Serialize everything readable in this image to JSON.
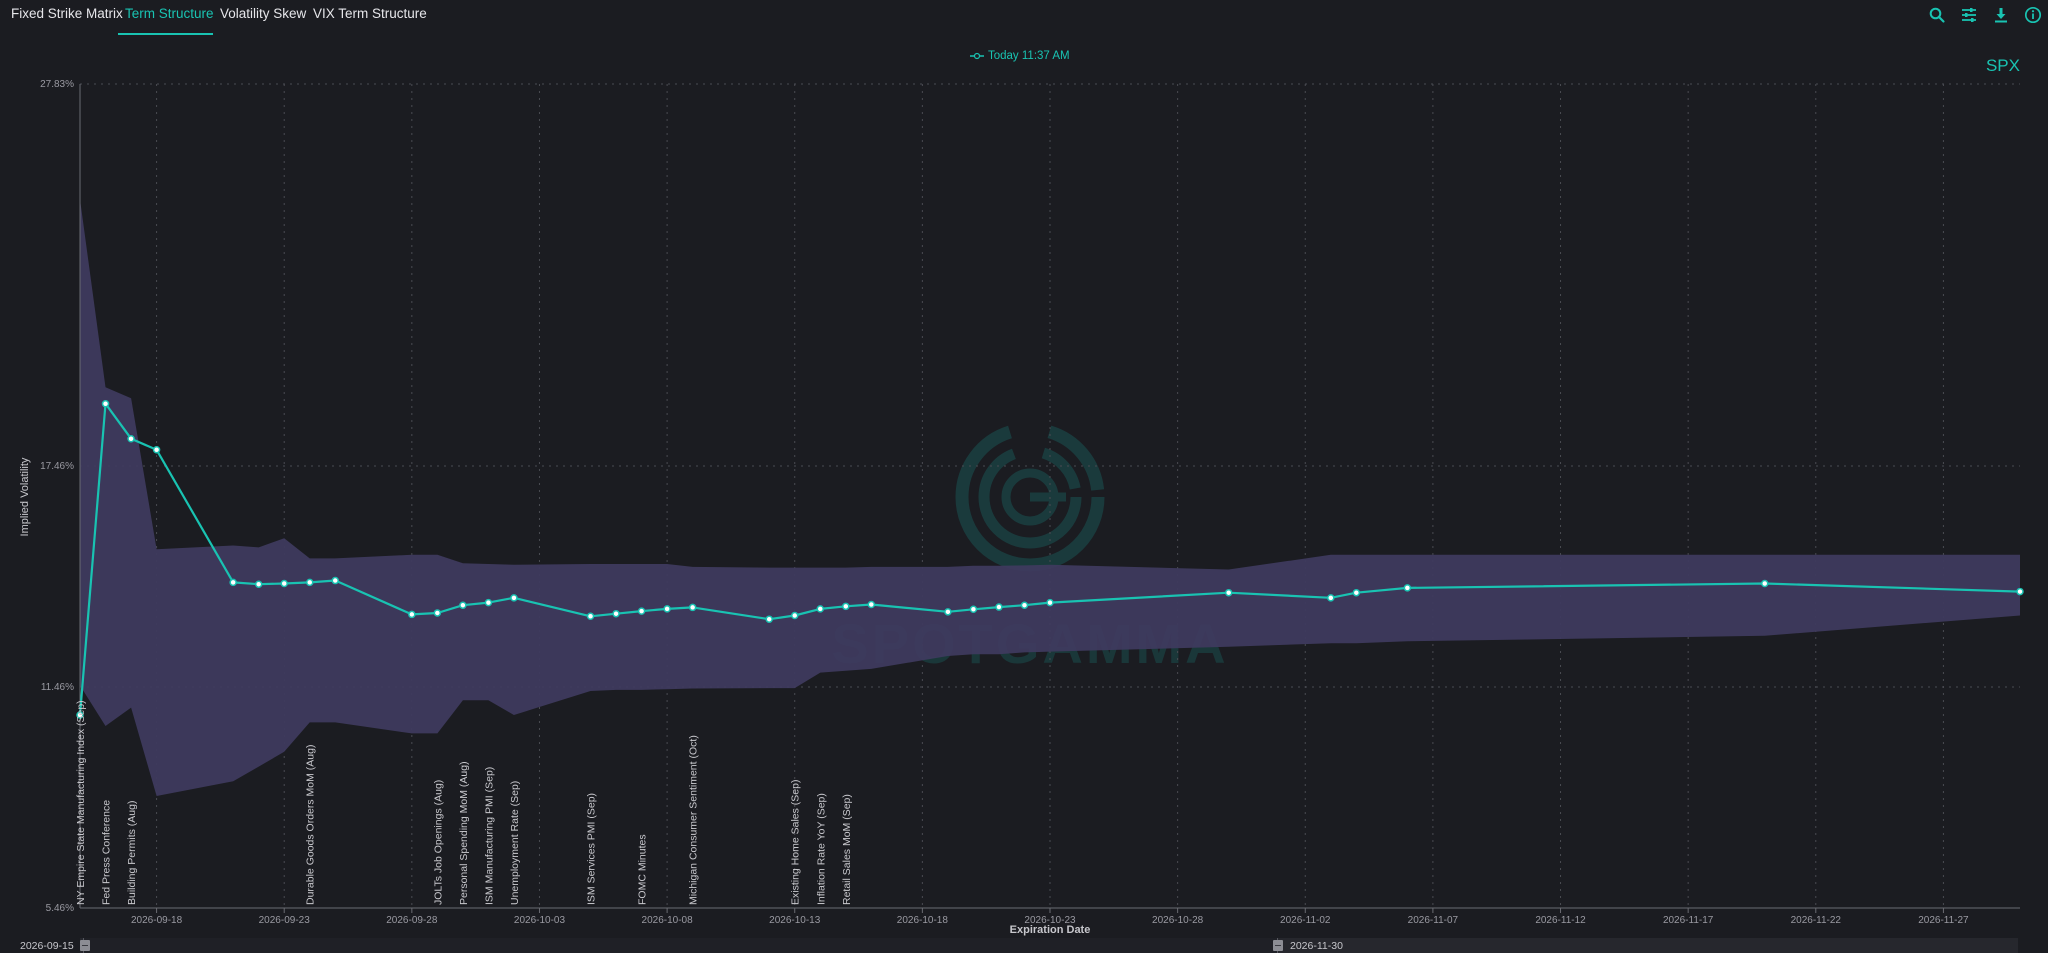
{
  "tabs": [
    {
      "label": "Fixed Strike Matrix",
      "active": false
    },
    {
      "label": "Term Structure",
      "active": true
    },
    {
      "label": "Volatility Skew",
      "active": false
    },
    {
      "label": "VIX Term Structure",
      "active": false
    }
  ],
  "toolbar": {
    "icons": [
      "search-icon",
      "sliders-icon",
      "download-icon",
      "info-icon"
    ]
  },
  "symbol": "SPX",
  "watermark": "SPOTGAMMA",
  "colors": {
    "accent": "#19c3b2",
    "band": "#3e3a5e",
    "background": "#1b1c21"
  },
  "navigator": {
    "start_label": "2026-09-15",
    "end_label": "2026-11-30"
  },
  "chart_data": {
    "type": "line",
    "title": "",
    "xlabel": "Expiration Date",
    "ylabel": "Implied Volatility",
    "x_type": "date",
    "xlim": [
      "2026-09-15",
      "2026-11-30"
    ],
    "ylim": [
      5.46,
      27.83
    ],
    "y_ticks": [
      "27.83%",
      "17.46%",
      "11.46%",
      "5.46%"
    ],
    "y_tick_values": [
      27.83,
      17.46,
      11.46,
      5.46
    ],
    "x_ticks": [
      "2026-09-18",
      "2026-09-23",
      "2026-09-28",
      "2026-10-03",
      "2026-10-08",
      "2026-10-13",
      "2026-10-18",
      "2026-10-23",
      "2026-10-28",
      "2026-11-02",
      "2026-11-07",
      "2026-11-12",
      "2026-11-17",
      "2026-11-22",
      "2026-11-27"
    ],
    "grid": true,
    "legend": {
      "position": "top-center"
    },
    "series": [
      {
        "name": "Today 11:37 AM",
        "color": "#19c3b2",
        "x": [
          "2026-09-15",
          "2026-09-16",
          "2026-09-17",
          "2026-09-18",
          "2026-09-21",
          "2026-09-22",
          "2026-09-23",
          "2026-09-24",
          "2026-09-25",
          "2026-09-28",
          "2026-09-29",
          "2026-09-30",
          "2026-10-01",
          "2026-10-02",
          "2026-10-05",
          "2026-10-06",
          "2026-10-07",
          "2026-10-08",
          "2026-10-09",
          "2026-10-12",
          "2026-10-13",
          "2026-10-14",
          "2026-10-15",
          "2026-10-16",
          "2026-10-19",
          "2026-10-20",
          "2026-10-21",
          "2026-10-22",
          "2026-10-23",
          "2026-10-30",
          "2026-11-03",
          "2026-11-04",
          "2026-11-06",
          "2026-11-20",
          "2026-11-30"
        ],
        "values": [
          10.7,
          19.15,
          18.2,
          17.9,
          14.3,
          14.25,
          14.27,
          14.3,
          14.35,
          13.43,
          13.47,
          13.68,
          13.75,
          13.88,
          13.38,
          13.45,
          13.52,
          13.58,
          13.62,
          13.3,
          13.4,
          13.58,
          13.65,
          13.7,
          13.5,
          13.57,
          13.63,
          13.68,
          13.75,
          14.02,
          13.88,
          14.02,
          14.15,
          14.27,
          14.05
        ]
      }
    ],
    "band": {
      "x": [
        "2026-09-15",
        "2026-09-16",
        "2026-09-17",
        "2026-09-18",
        "2026-09-21",
        "2026-09-22",
        "2026-09-23",
        "2026-09-24",
        "2026-09-25",
        "2026-09-28",
        "2026-09-29",
        "2026-09-30",
        "2026-10-01",
        "2026-10-02",
        "2026-10-05",
        "2026-10-06",
        "2026-10-07",
        "2026-10-08",
        "2026-10-09",
        "2026-10-12",
        "2026-10-13",
        "2026-10-14",
        "2026-10-15",
        "2026-10-16",
        "2026-10-19",
        "2026-10-20",
        "2026-10-21",
        "2026-10-22",
        "2026-10-23",
        "2026-10-30",
        "2026-11-03",
        "2026-11-04",
        "2026-11-06",
        "2026-11-20",
        "2026-11-30"
      ],
      "upper": [
        24.7,
        19.6,
        19.3,
        15.2,
        15.3,
        15.25,
        15.5,
        14.95,
        14.95,
        15.05,
        15.05,
        14.82,
        14.8,
        14.78,
        14.8,
        14.8,
        14.8,
        14.8,
        14.72,
        14.7,
        14.7,
        14.7,
        14.7,
        14.72,
        14.72,
        14.75,
        14.75,
        14.76,
        14.78,
        14.65,
        15.05,
        15.05,
        15.05,
        15.05,
        15.05
      ],
      "lower": [
        11.5,
        10.4,
        10.9,
        8.5,
        8.9,
        9.3,
        9.7,
        10.5,
        10.5,
        10.2,
        10.2,
        11.1,
        11.1,
        10.7,
        11.35,
        11.38,
        11.38,
        11.4,
        11.42,
        11.43,
        11.43,
        11.85,
        11.9,
        11.95,
        12.3,
        12.35,
        12.35,
        12.4,
        12.42,
        12.55,
        12.65,
        12.65,
        12.7,
        12.85,
        13.4
      ]
    },
    "events": [
      {
        "date": "2026-09-15",
        "label": "NY Empire State Manufacturing Index (Sep)"
      },
      {
        "date": "2026-09-16",
        "label": "Fed Press Conference"
      },
      {
        "date": "2026-09-17",
        "label": "Building Permits (Aug)"
      },
      {
        "date": "2026-09-24",
        "label": "Durable Goods Orders MoM (Aug)"
      },
      {
        "date": "2026-09-29",
        "label": "JOLTs Job Openings (Aug)"
      },
      {
        "date": "2026-09-30",
        "label": "Personal Spending MoM (Aug)"
      },
      {
        "date": "2026-10-01",
        "label": "ISM Manufacturing PMI (Sep)"
      },
      {
        "date": "2026-10-02",
        "label": "Unemployment Rate (Sep)"
      },
      {
        "date": "2026-10-05",
        "label": "ISM Services PMI (Sep)"
      },
      {
        "date": "2026-10-07",
        "label": "FOMC Minutes"
      },
      {
        "date": "2026-10-09",
        "label": "Michigan Consumer Sentiment (Oct)"
      },
      {
        "date": "2026-10-13",
        "label": "Existing Home Sales (Sep)"
      },
      {
        "date": "2026-10-14",
        "label": "Inflation Rate YoY (Sep)"
      },
      {
        "date": "2026-10-15",
        "label": "Retail Sales MoM (Sep)"
      }
    ]
  }
}
